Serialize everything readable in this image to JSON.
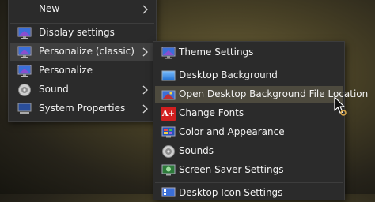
{
  "main_menu": {
    "items": [
      {
        "label": "New",
        "icon": "none",
        "submenu": true
      },
      {
        "label": "Display settings",
        "icon": "monitor-icon",
        "submenu": false
      },
      {
        "label": "Personalize (classic)",
        "icon": "monitor-icon",
        "submenu": true
      },
      {
        "label": "Personalize",
        "icon": "monitor-icon",
        "submenu": false
      },
      {
        "label": "Sound",
        "icon": "speaker-icon",
        "submenu": true
      },
      {
        "label": "System Properties",
        "icon": "computer-icon",
        "submenu": true
      }
    ]
  },
  "sub_menu": {
    "items": [
      {
        "label": "Theme Settings",
        "icon": "monitor-icon"
      },
      {
        "label": "Desktop Background",
        "icon": "wallpaper-icon"
      },
      {
        "label": "Open Desktop Background File Location",
        "icon": "folder-image-icon"
      },
      {
        "label": "Change Fonts",
        "icon": "font-icon",
        "icon_text": "A+"
      },
      {
        "label": "Color and Appearance",
        "icon": "palette-icon"
      },
      {
        "label": "Sounds",
        "icon": "speaker-icon"
      },
      {
        "label": "Screen Saver Settings",
        "icon": "screensaver-icon"
      },
      {
        "label": "Desktop Icon Settings",
        "icon": "desktop-icons-icon"
      }
    ]
  },
  "colors": {
    "menu_bg": "#2b2b2b",
    "hover_bg": "#4d4a3e",
    "active_bg": "#3f3f3f",
    "text": "#f2f2f2"
  }
}
